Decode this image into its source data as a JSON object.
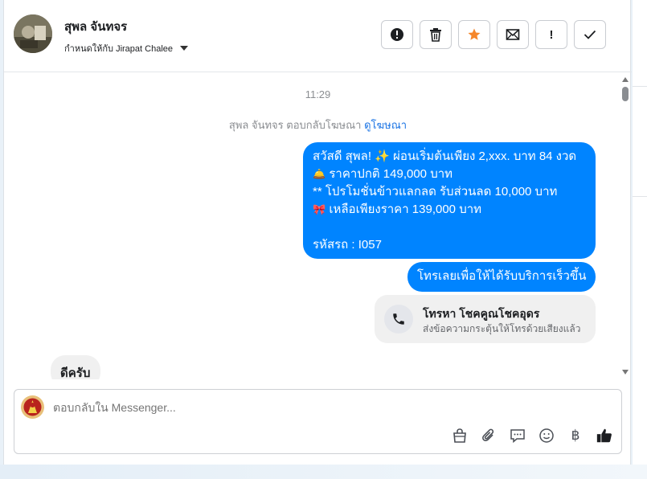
{
  "header": {
    "contact_name": "สุพล จันทจร",
    "assign_label": "กำหนดให้กับ Jirapat Chalee"
  },
  "toolbar": {
    "buttons": [
      "spam",
      "delete",
      "star",
      "mark-unread",
      "follow-up",
      "done"
    ],
    "follow_up_glyph": "!"
  },
  "chat": {
    "timestamp": "11:29",
    "system_text": "สุพล จันทจร ตอบกลับโฆษณา",
    "system_link": "ดูโฆษณา",
    "ad_message": {
      "line1": "สวัสดี สุพล! ✨  ผ่อนเริ่มต้นเพียง 2,xxx. บาท 84 งวด",
      "line2_emoji": "🛎️",
      "line2": " ราคาปกติ 149,000 บาท",
      "line3": "** โปรโมชั่นข้าวแลกลด รับส่วนลด 10,000 บาท",
      "line4_emoji": "🎀",
      "line4": "  เหลือเพียงราคา 139,000 บาท",
      "line5": "",
      "line6": " รหัสรถ : I057"
    },
    "call_prompt": "โทรเลยเพื่อให้ได้รับบริการเร็วขึ้น",
    "call_card": {
      "title": "โทรหา โชคคูณโชคอุดร",
      "subtitle": "ส่งข้อความกระตุ้นให้โทรด้วยเสียงแล้ว"
    },
    "customer_reply": "ดีครับ"
  },
  "composer": {
    "placeholder": "ตอบกลับใน Messenger...",
    "tools": [
      "bag-icon",
      "paperclip-icon",
      "saved-reply-icon",
      "emoji-icon",
      "baht-icon",
      "like-icon"
    ],
    "baht_glyph": "฿"
  },
  "colors": {
    "accent": "#0084ff",
    "link": "#1b74e4",
    "star": "#f5862a"
  }
}
